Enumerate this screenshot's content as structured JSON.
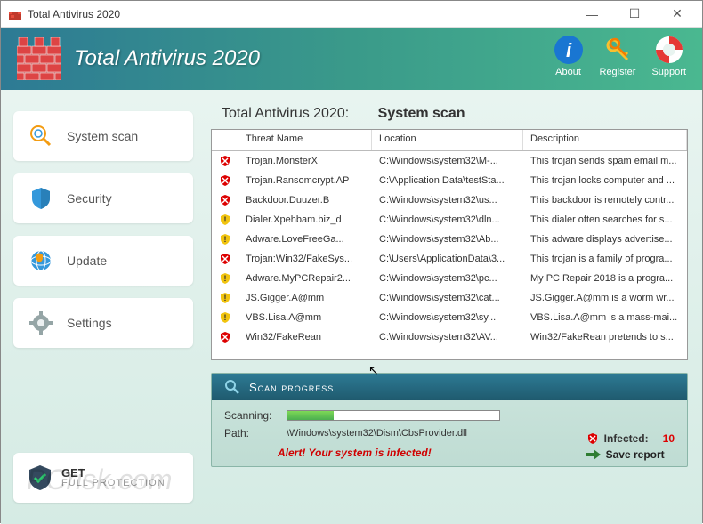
{
  "window": {
    "title": "Total Antivirus 2020"
  },
  "header": {
    "app_title": "Total Antivirus 2020",
    "buttons": {
      "about": "About",
      "register": "Register",
      "support": "Support"
    }
  },
  "sidebar": {
    "items": [
      {
        "label": "System scan"
      },
      {
        "label": "Security"
      },
      {
        "label": "Update"
      },
      {
        "label": "Settings"
      }
    ],
    "promo": {
      "line1": "GET",
      "line2": "FULL PROTECTION"
    }
  },
  "main": {
    "title_prefix": "Total Antivirus 2020:",
    "title_label": "System scan",
    "columns": {
      "name": "Threat Name",
      "location": "Location",
      "description": "Description"
    },
    "threats": [
      {
        "icon": "red",
        "name": "Trojan.MonsterX",
        "location": "C:\\Windows\\system32\\M-...",
        "description": "This trojan sends spam email m..."
      },
      {
        "icon": "red",
        "name": "Trojan.Ransomcrypt.AP",
        "location": "C:\\Application Data\\testSta...",
        "description": "This trojan locks computer and ..."
      },
      {
        "icon": "red",
        "name": "Backdoor.Duuzer.B",
        "location": "C:\\Windows\\system32\\us...",
        "description": "This backdoor is remotely contr..."
      },
      {
        "icon": "yellow",
        "name": "Dialer.Xpehbam.biz_d",
        "location": "C:\\Windows\\system32\\dln...",
        "description": "This dialer often searches for s..."
      },
      {
        "icon": "yellow",
        "name": "Adware.LoveFreeGa...",
        "location": "C:\\Windows\\system32\\Ab...",
        "description": "This adware displays advertise..."
      },
      {
        "icon": "red",
        "name": "Trojan:Win32/FakeSys...",
        "location": "C:\\Users\\ApplicationData\\3...",
        "description": "This trojan is a family of progra..."
      },
      {
        "icon": "yellow",
        "name": "Adware.MyPCRepair2...",
        "location": "C:\\Windows\\system32\\pc...",
        "description": "My PC Repair 2018 is a progra..."
      },
      {
        "icon": "yellow",
        "name": "JS.Gigger.A@mm",
        "location": "C:\\Windows\\system32\\cat...",
        "description": "JS.Gigger.A@mm is a worm wr..."
      },
      {
        "icon": "yellow",
        "name": "VBS.Lisa.A@mm",
        "location": "C:\\Windows\\system32\\sy...",
        "description": "VBS.Lisa.A@mm is a mass-mai..."
      },
      {
        "icon": "red",
        "name": "Win32/FakeRean",
        "location": "C:\\Windows\\system32\\AV...",
        "description": "Win32/FakeRean pretends to s..."
      }
    ]
  },
  "progress": {
    "header": "Scan progress",
    "scanning_label": "Scanning:",
    "path_label": "Path:",
    "path_value": "\\Windows\\system32\\Dism\\CbsProvider.dll",
    "alert": "Alert! Your system is infected!",
    "infected_label": "Infected:",
    "infected_count": "10",
    "save_report": "Save report"
  },
  "watermark": "PCrisk.com"
}
